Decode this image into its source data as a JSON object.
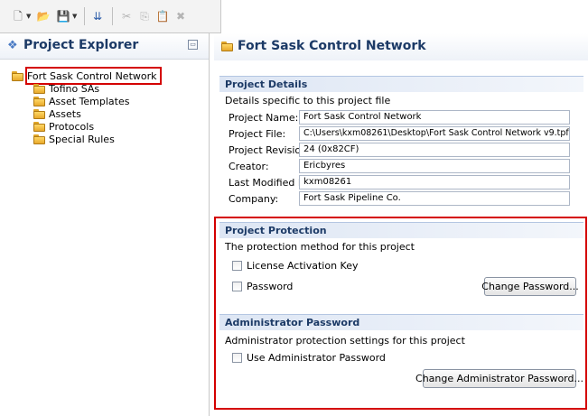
{
  "toolbar": {
    "icons": [
      "new-icon",
      "dropdown-arrow-icon",
      "open-folder-icon",
      "save-icon",
      "dropdown-arrow-icon",
      "import-icon",
      "cut-icon",
      "copy-icon",
      "paste-icon",
      "delete-icon"
    ]
  },
  "project_explorer": {
    "title": "Project Explorer",
    "minimize_glyph": "▭",
    "root": "Fort Sask Control Network",
    "children": [
      "Tofino SAs",
      "Asset Templates",
      "Assets",
      "Protocols",
      "Special Rules"
    ]
  },
  "editor": {
    "title": "Fort Sask Control Network",
    "project_details": {
      "heading": "Project Details",
      "description": "Details specific to this project file",
      "fields": [
        {
          "label": "Project Name:",
          "value": "Fort Sask Control Network"
        },
        {
          "label": "Project File:",
          "value": "C:\\Users\\kxm08261\\Desktop\\Fort Sask Control Network v9.tpf"
        },
        {
          "label": "Project Revision:",
          "value": "24 (0x82CF)"
        },
        {
          "label": "Creator:",
          "value": "Ericbyres"
        },
        {
          "label": "Last Modified By:",
          "value": "kxm08261"
        },
        {
          "label": "Company:",
          "value": "Fort Sask Pipeline Co."
        }
      ]
    },
    "project_protection": {
      "heading": "Project Protection",
      "description": "The protection method for this project",
      "license_label": "License Activation Key",
      "license_checked": false,
      "password_label": "Password",
      "password_checked": false,
      "change_password_button": "Change Password..."
    },
    "administrator_password": {
      "heading": "Administrator Password",
      "description": "Administrator protection settings for this project",
      "use_admin_label": "Use Administrator Password",
      "use_admin_checked": false,
      "change_admin_button": "Change Administrator Password..."
    }
  },
  "colors": {
    "highlight_border": "#d40000",
    "section_title": "#1c3a66"
  }
}
